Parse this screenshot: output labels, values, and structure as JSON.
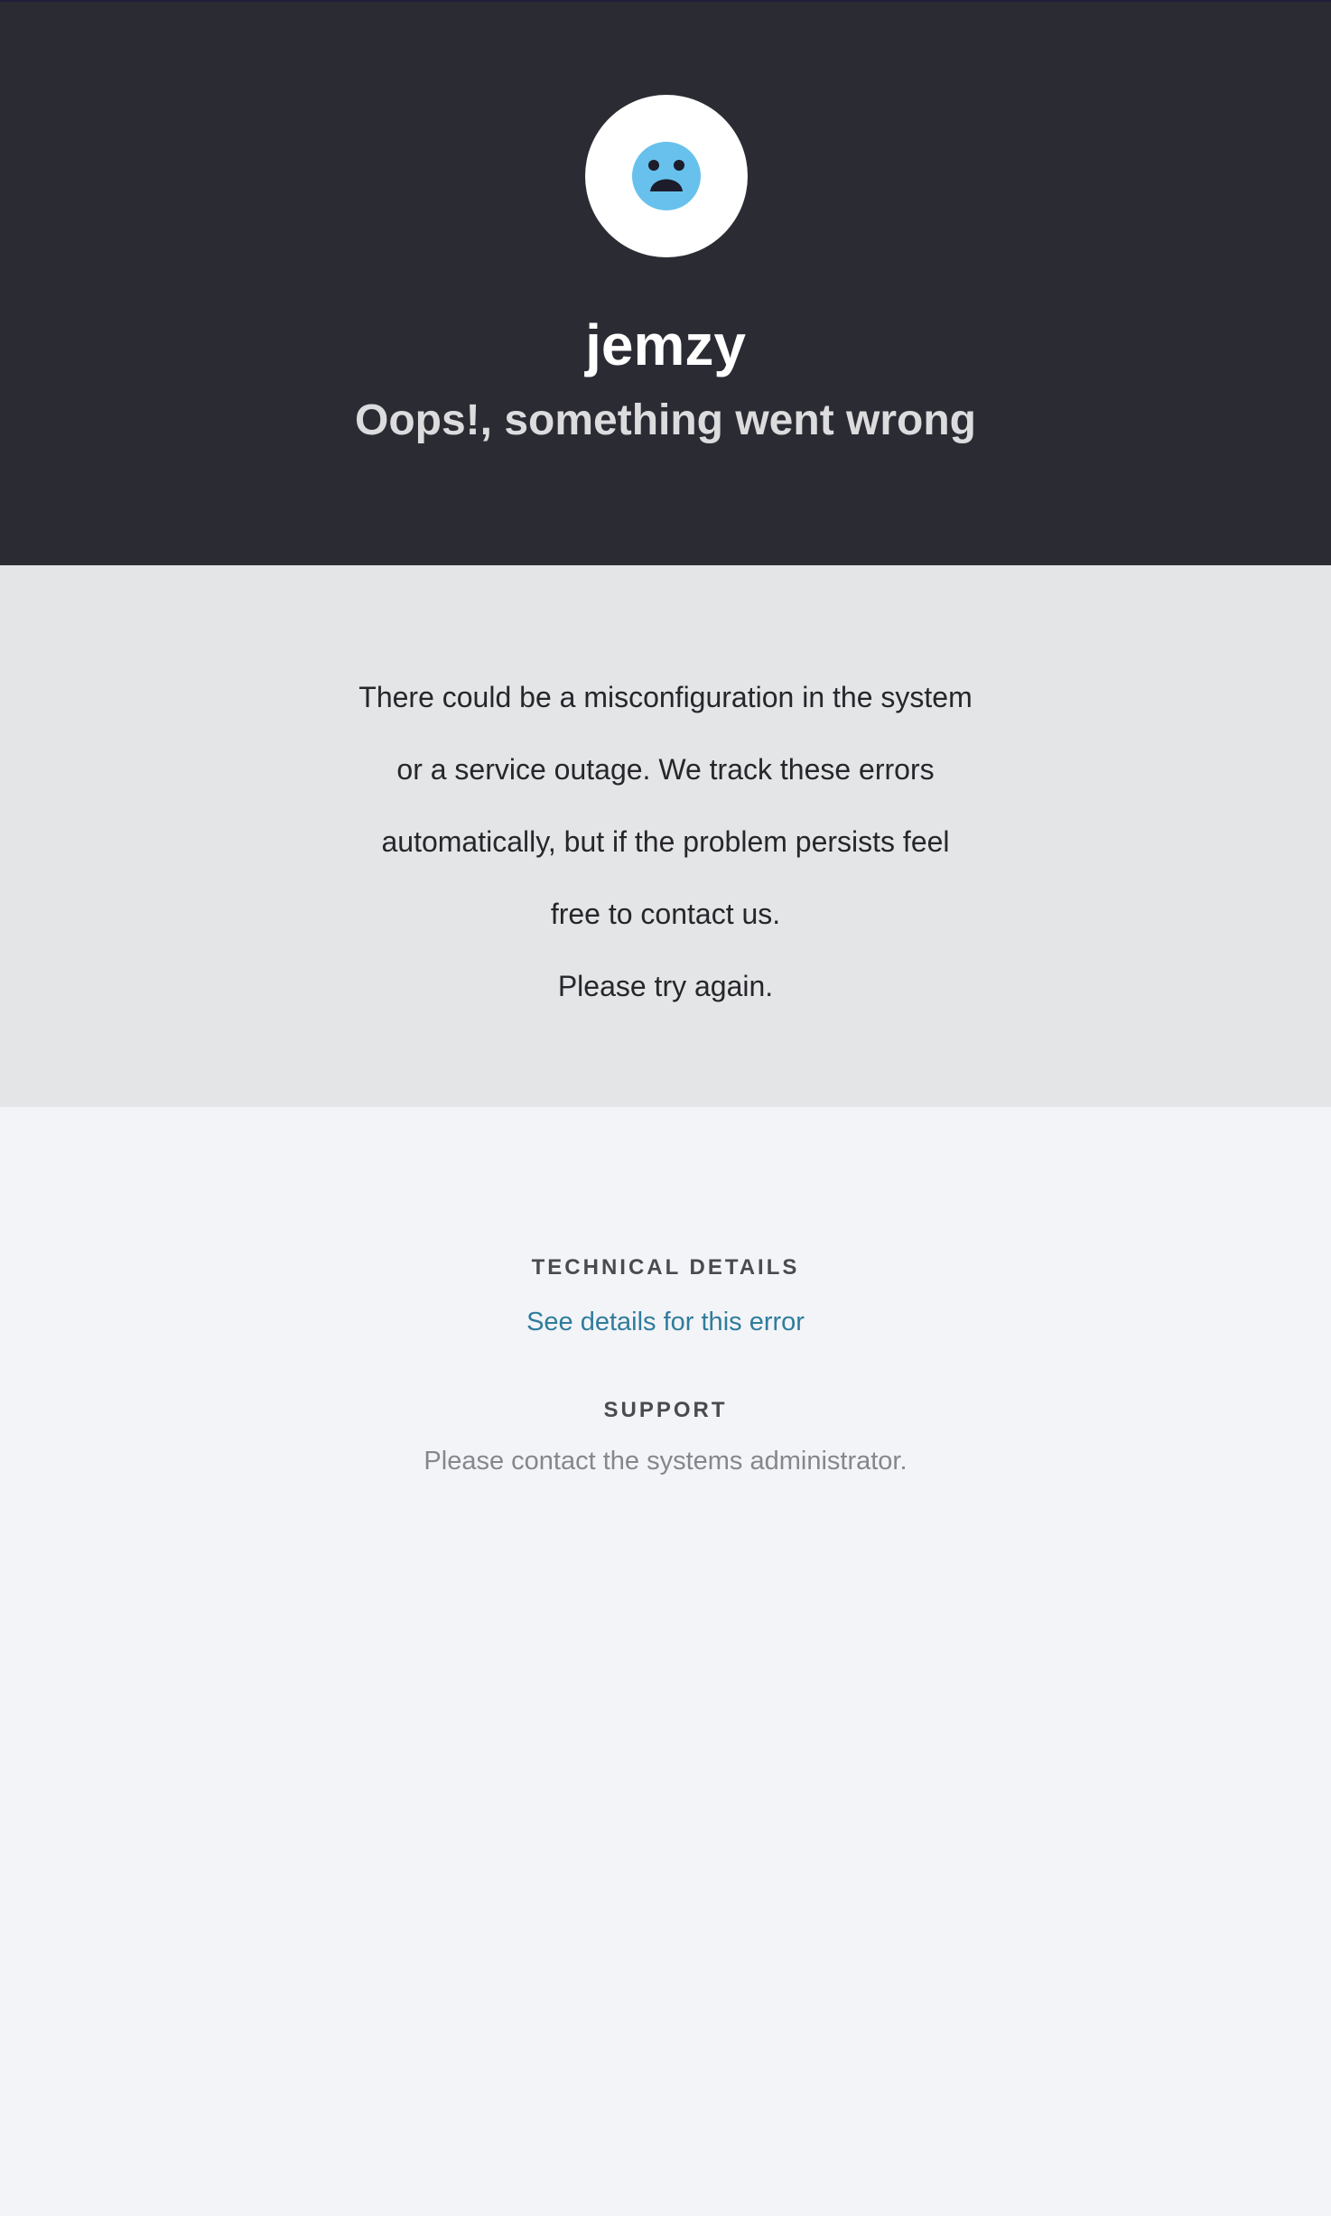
{
  "brand": {
    "name": "jemzy",
    "icon": "sad-face-icon",
    "icon_color": "#67c1ec"
  },
  "hero": {
    "subtitle": "Oops!, something went wrong"
  },
  "message": {
    "lines": [
      "There could be a misconfiguration in the system",
      "or a service outage. We track these errors",
      "automatically, but if the problem persists feel",
      "free to contact us."
    ],
    "retry": "Please try again."
  },
  "technical": {
    "heading": "TECHNICAL DETAILS",
    "link_label": "See details for this error"
  },
  "support": {
    "heading": "SUPPORT",
    "text": "Please contact the systems administrator."
  },
  "colors": {
    "hero_bg": "#2b2c33",
    "message_bg": "#e4e5e7",
    "page_bg": "#f3f4f8",
    "link": "#2f7c9c"
  }
}
